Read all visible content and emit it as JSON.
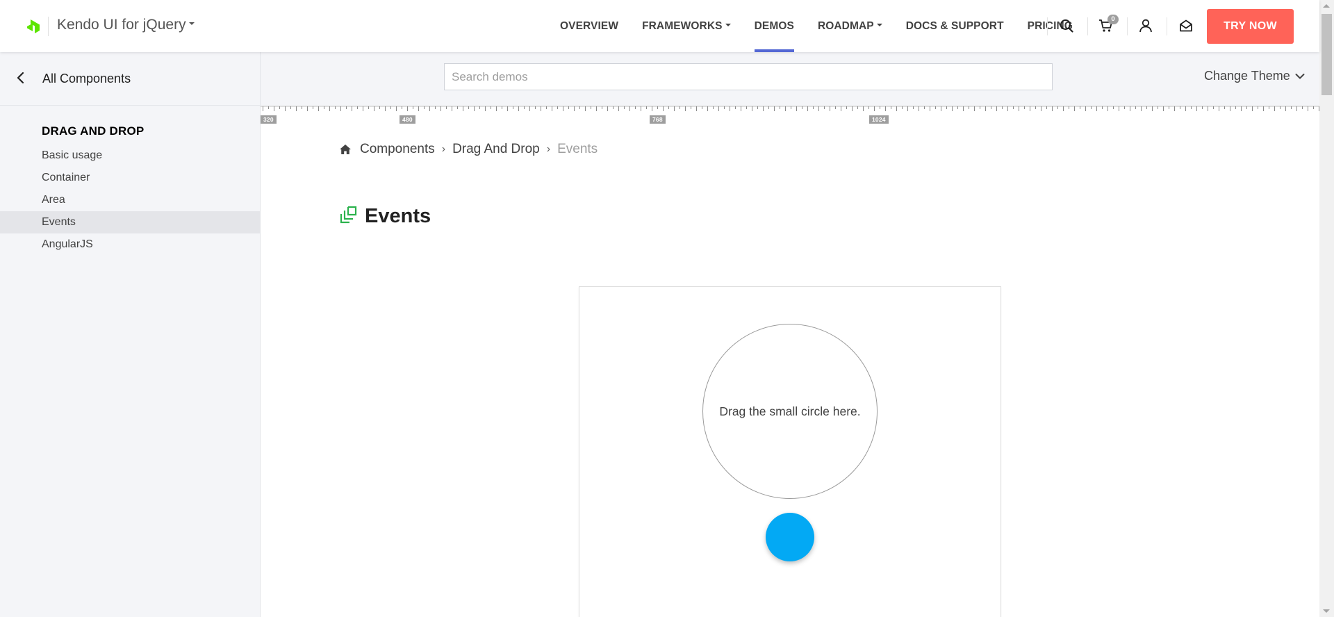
{
  "header": {
    "product_name": "Kendo UI for jQuery",
    "nav": [
      {
        "label": "OVERVIEW",
        "dropdown": false,
        "active": false
      },
      {
        "label": "FRAMEWORKS",
        "dropdown": true,
        "active": false
      },
      {
        "label": "DEMOS",
        "dropdown": false,
        "active": true
      },
      {
        "label": "ROADMAP",
        "dropdown": true,
        "active": false
      },
      {
        "label": "DOCS & SUPPORT",
        "dropdown": false,
        "active": false
      },
      {
        "label": "PRICING",
        "dropdown": false,
        "active": false
      }
    ],
    "icons": [
      "search-icon",
      "cart-icon",
      "user-icon",
      "mail-icon"
    ],
    "cart_count": "0",
    "cta_label": "TRY NOW",
    "cta_color": "#ff6358",
    "accent_color": "#5468d4",
    "logo_color": "#5ce500"
  },
  "sidebar": {
    "back_label": "All Components",
    "section_title": "DRAG AND DROP",
    "items": [
      {
        "label": "Basic usage",
        "active": false
      },
      {
        "label": "Container",
        "active": false
      },
      {
        "label": "Area",
        "active": false
      },
      {
        "label": "Events",
        "active": true
      },
      {
        "label": "AngularJS",
        "active": false
      }
    ]
  },
  "toolbar": {
    "search_placeholder": "Search demos",
    "search_value": "",
    "theme_label": "Change Theme"
  },
  "ruler": {
    "breakpoints": [
      "320",
      "480",
      "768",
      "1024"
    ]
  },
  "breadcrumb": {
    "items": [
      "Components",
      "Drag And Drop"
    ],
    "current": "Events"
  },
  "page": {
    "title": "Events",
    "title_icon": "drag-and-drop-icon"
  },
  "demo": {
    "drop_target_text": "Drag the small circle here.",
    "draggable_color": "#03a9f4"
  }
}
